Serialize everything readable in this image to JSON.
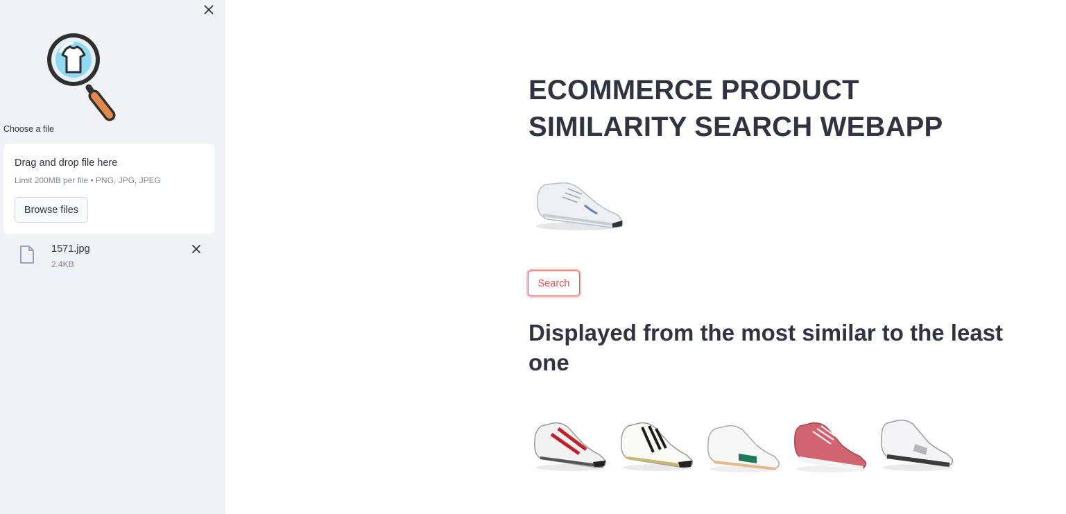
{
  "sidebar": {
    "upload_label": "Choose a file",
    "dropzone_title": "Drag and drop file here",
    "dropzone_limit": "Limit 200MB per file • PNG, JPG, JPEG",
    "browse_label": "Browse files",
    "file": {
      "name": "1571.jpg",
      "size": "2.4KB"
    }
  },
  "main": {
    "title": "ECOMMERCE PRODUCT SIMILARITY SEARCH WEBAPP",
    "search_label": "Search",
    "results_heading": "Displayed from the most similar to the least one",
    "result_count": 5
  },
  "colors": {
    "sidebar_bg": "#f0f2f6",
    "accent": "#ff4b4b",
    "text": "#31333f",
    "muted": "#808495"
  },
  "icons": {
    "sidebar_close": "close-icon",
    "file": "file-icon",
    "file_remove": "close-icon",
    "logo": "magnifier-shirt-logo"
  }
}
